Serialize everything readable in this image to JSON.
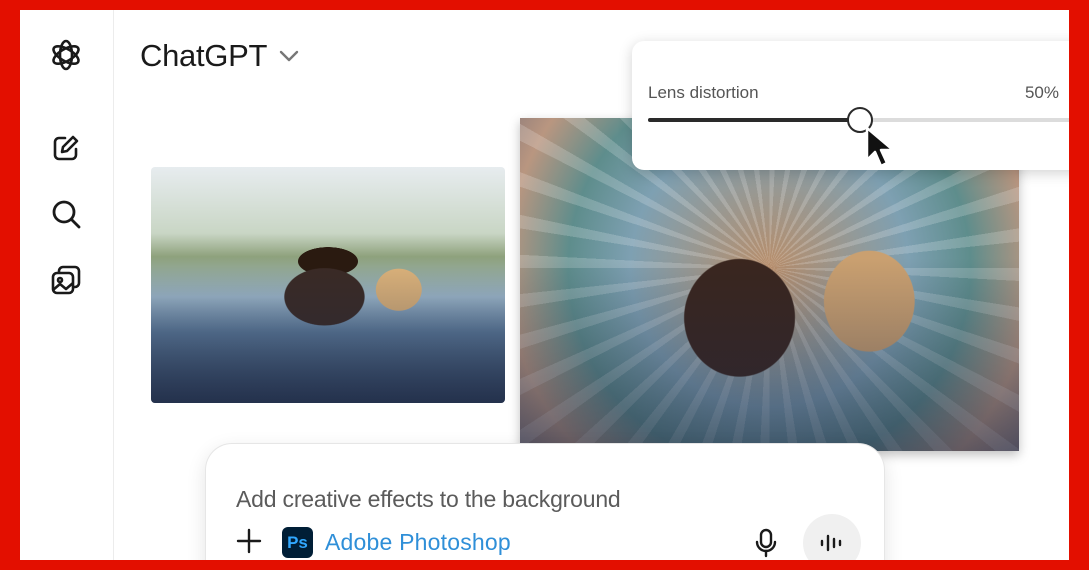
{
  "header": {
    "title": "ChatGPT"
  },
  "sidebar": {
    "items": [
      {
        "icon": "openai-logo-icon"
      },
      {
        "icon": "new-chat-icon"
      },
      {
        "icon": "search-icon"
      },
      {
        "icon": "images-icon"
      }
    ]
  },
  "adjustment": {
    "label": "Lens distortion",
    "value_text": "50%",
    "value": 0.5
  },
  "composer": {
    "prompt": "Add creative effects to the background",
    "app_name": "Adobe Photoshop",
    "app_logo": "Ps"
  },
  "colors": {
    "border": "#e30f00",
    "photoshop_blue": "#31a8ff",
    "photoshop_bg": "#001e36",
    "link_blue": "#2f8fd8"
  }
}
